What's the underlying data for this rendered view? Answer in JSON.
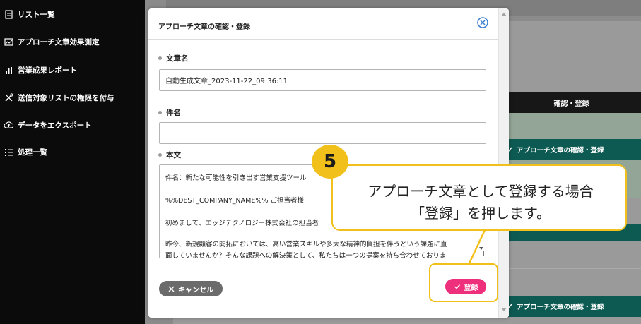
{
  "sidebar": {
    "items": [
      {
        "label": "リスト一覧",
        "icon": "document-icon"
      },
      {
        "label": "アプローチ文章効果測定",
        "icon": "chart-frame-icon"
      },
      {
        "label": "営業成果レポート",
        "icon": "bar-chart-icon"
      },
      {
        "label": "送信対象リストの権限を付与",
        "icon": "tools-icon"
      },
      {
        "label": "データをエクスポート",
        "icon": "cloud-upload-icon"
      },
      {
        "label": "処理一覧",
        "icon": "list-icon"
      }
    ]
  },
  "background": {
    "column_header": "確認・登録",
    "pill_label": "アプローチ文章の確認・登録"
  },
  "modal": {
    "title": "アプローチ文章の確認・登録",
    "fields": {
      "name_label": "文章名",
      "name_value": "自動生成文章_2023-11-22_09:36:11",
      "subject_label": "件名",
      "subject_value": "",
      "body_label": "本文",
      "body_lines": [
        "件名：新たな可能性を引き出す営業支援ツール",
        "%%DEST_COMPANY_NAME%% ご担当者様",
        "初めまして、エッジテクノロジー株式会社の担当者",
        "昨今、新規顧客の開拓においては、高い営業スキルや多大な精神的負担を伴うという課題に直",
        "面していませんか？そんな課題への解決策として、私たちは一つの提案を持ち合わせておりま"
      ]
    },
    "cancel_label": "キャンセル",
    "register_label": "登録"
  },
  "annotation": {
    "step_number": "5",
    "line1": "アプローチ文章として登録する場合",
    "line2": "「登録」を押します。",
    "accent_color": "#f2c01b"
  },
  "colors": {
    "sidebar_bg": "#0b0b0b",
    "register_pink": "#ee2f7b",
    "pill_teal": "#0d5a52"
  }
}
